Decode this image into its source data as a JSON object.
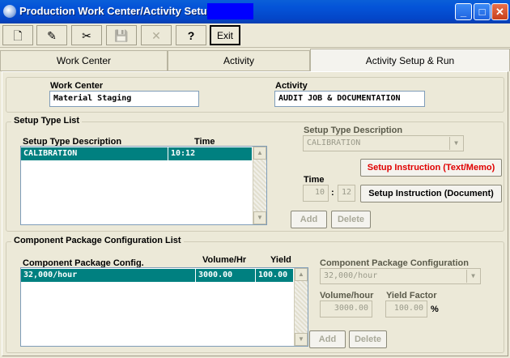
{
  "window": {
    "title": "Production Work Center/Activity Setup",
    "minimize_glyph": "_",
    "maximize_glyph": "□",
    "close_glyph": "✕"
  },
  "toolbar": {
    "new_glyph": "🗋",
    "edit_glyph": "✎",
    "cut_glyph": "✂",
    "save_glyph": "💾",
    "delete_glyph": "✕",
    "help_glyph": "?",
    "exit_label": "Exit"
  },
  "tabs": [
    {
      "label": "Work Center"
    },
    {
      "label": "Activity"
    },
    {
      "label": "Activity Setup & Run"
    }
  ],
  "header": {
    "work_center_label": "Work Center",
    "work_center_value": "Material Staging",
    "activity_label": "Activity",
    "activity_value": "AUDIT JOB & DOCUMENTATION"
  },
  "setup": {
    "group_title": "Setup Type List",
    "col_description": "Setup Type Description",
    "col_time": "Time",
    "rows": [
      {
        "description": "CALIBRATION",
        "time": "10:12"
      }
    ],
    "detail_desc_label": "Setup Type Description",
    "detail_desc_value": "CALIBRATION",
    "time_label": "Time",
    "time_hours": "10",
    "time_sep": ":",
    "time_minutes": "12",
    "btn_instruction_text": "Setup Instruction (Text/Memo)",
    "btn_instruction_doc": "Setup Instruction (Document)",
    "btn_add": "Add",
    "btn_delete": "Delete"
  },
  "component": {
    "group_title": "Component Package Configuration List",
    "col_config": "Component Package Config.",
    "col_volume": "Volume/Hr",
    "col_yield": "Yield",
    "rows": [
      {
        "config": "32,000/hour",
        "volume": "3000.00",
        "yield": "100.00"
      }
    ],
    "detail_config_label": "Component Package Configuration",
    "detail_config_value": "32,000/hour",
    "volume_label": "Volume/hour",
    "volume_value": "3000.00",
    "yield_label": "Yield Factor",
    "yield_value": "100.00",
    "yield_unit": "%",
    "btn_add": "Add",
    "btn_delete": "Delete"
  },
  "colors": {
    "title_bar": "#0454d8",
    "selected_row": "#008080",
    "red_button_text": "#e00000"
  }
}
